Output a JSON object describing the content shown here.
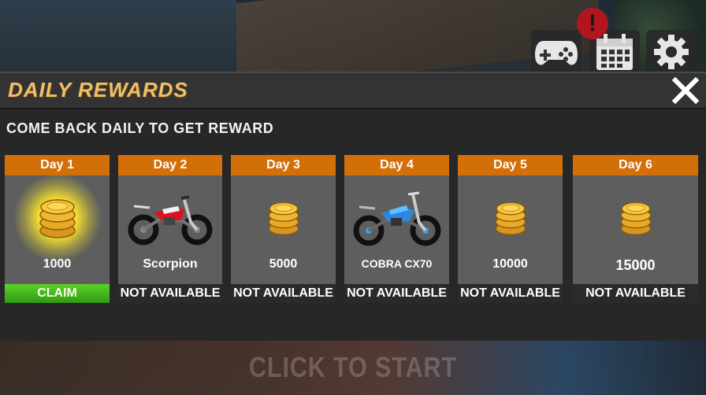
{
  "background": {
    "start_text": "CLICK TO START"
  },
  "topbar": {
    "alert_badge": "!",
    "buttons": [
      {
        "name": "gamepad",
        "icon": "gamepad-icon"
      },
      {
        "name": "calendar",
        "icon": "calendar-icon"
      },
      {
        "name": "settings",
        "icon": "gear-icon"
      }
    ]
  },
  "dialog": {
    "title": "DAILY REWARDS",
    "subtitle": "COME BACK DAILY TO GET REWARD",
    "close_icon": "close-icon",
    "colors": {
      "header_orange": "#d36f08",
      "claim_green": "#4cc21e",
      "title_gold": "#f0c068"
    },
    "days": [
      {
        "day": "Day 1",
        "reward": "1000",
        "type": "coins",
        "status": "CLAIM",
        "claimable": true
      },
      {
        "day": "Day 2",
        "reward": "Scorpion",
        "type": "bike-red",
        "status": "NOT AVAILABLE",
        "claimable": false
      },
      {
        "day": "Day 3",
        "reward": "5000",
        "type": "coins",
        "status": "NOT AVAILABLE",
        "claimable": false
      },
      {
        "day": "Day 4",
        "reward": "COBRA CX70",
        "type": "bike-blue",
        "status": "NOT AVAILABLE",
        "claimable": false
      },
      {
        "day": "Day 5",
        "reward": "10000",
        "type": "coins",
        "status": "NOT AVAILABLE",
        "claimable": false
      },
      {
        "day": "Day 6",
        "reward": "15000",
        "type": "coins",
        "status": "NOT AVAILABLE",
        "claimable": false
      }
    ]
  }
}
